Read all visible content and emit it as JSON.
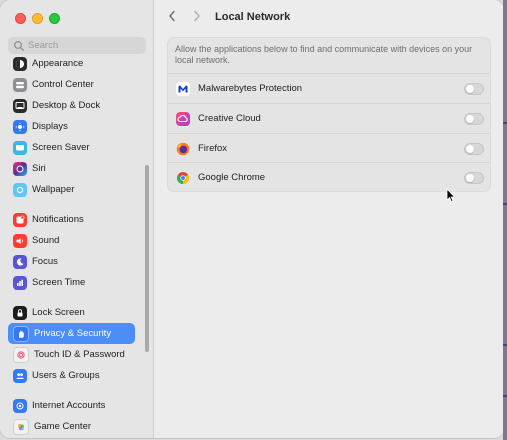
{
  "window": {
    "title": "Local Network"
  },
  "search": {
    "placeholder": "Search"
  },
  "sidebar": {
    "items": [
      {
        "label": "Appearance",
        "icon": "appearance-icon",
        "color": "#2b2b2b",
        "selected": false
      },
      {
        "label": "Control Center",
        "icon": "control-center-icon",
        "color": "#8e8e93",
        "selected": false
      },
      {
        "label": "Desktop & Dock",
        "icon": "desktop-dock-icon",
        "color": "#2b2b2b",
        "selected": false
      },
      {
        "label": "Displays",
        "icon": "displays-icon",
        "color": "#3478f6",
        "selected": false
      },
      {
        "label": "Screen Saver",
        "icon": "screen-saver-icon",
        "color": "#38b6e8",
        "selected": false
      },
      {
        "label": "Siri",
        "icon": "siri-icon",
        "color": "#5b2d8f",
        "selected": false
      },
      {
        "label": "Wallpaper",
        "icon": "wallpaper-icon",
        "color": "#5ac8fa",
        "selected": false
      },
      {
        "label": "Notifications",
        "icon": "notifications-icon",
        "color": "#ff3b30",
        "selected": false
      },
      {
        "label": "Sound",
        "icon": "sound-icon",
        "color": "#ff3b30",
        "selected": false
      },
      {
        "label": "Focus",
        "icon": "focus-icon",
        "color": "#5856d6",
        "selected": false
      },
      {
        "label": "Screen Time",
        "icon": "screen-time-icon",
        "color": "#5856d6",
        "selected": false
      },
      {
        "label": "Lock Screen",
        "icon": "lock-screen-icon",
        "color": "#1c1c1e",
        "selected": false
      },
      {
        "label": "Privacy & Security",
        "icon": "privacy-hand-icon",
        "color": "#3478f6",
        "selected": true
      },
      {
        "label": "Touch ID & Password",
        "icon": "touch-id-icon",
        "color": "#f2f2f2",
        "selected": false
      },
      {
        "label": "Users & Groups",
        "icon": "users-groups-icon",
        "color": "#3478f6",
        "selected": false
      },
      {
        "label": "Internet Accounts",
        "icon": "internet-accounts-icon",
        "color": "#3478f6",
        "selected": false
      },
      {
        "label": "Game Center",
        "icon": "game-center-icon",
        "color": "#f2f2f2",
        "selected": false
      }
    ]
  },
  "main": {
    "description": "Allow the applications below to find and communicate with devices on your local network.",
    "apps": [
      {
        "name": "Malwarebytes Protection",
        "icon": "malwarebytes-icon",
        "enabled": false
      },
      {
        "name": "Creative Cloud",
        "icon": "creative-cloud-icon",
        "enabled": false
      },
      {
        "name": "Firefox",
        "icon": "firefox-icon",
        "enabled": false
      },
      {
        "name": "Google Chrome",
        "icon": "chrome-icon",
        "enabled": false
      }
    ]
  },
  "colors": {
    "accent": "#4c8ef7",
    "sidebar_bg": "#e5e5e5",
    "content_bg": "#ececec"
  }
}
